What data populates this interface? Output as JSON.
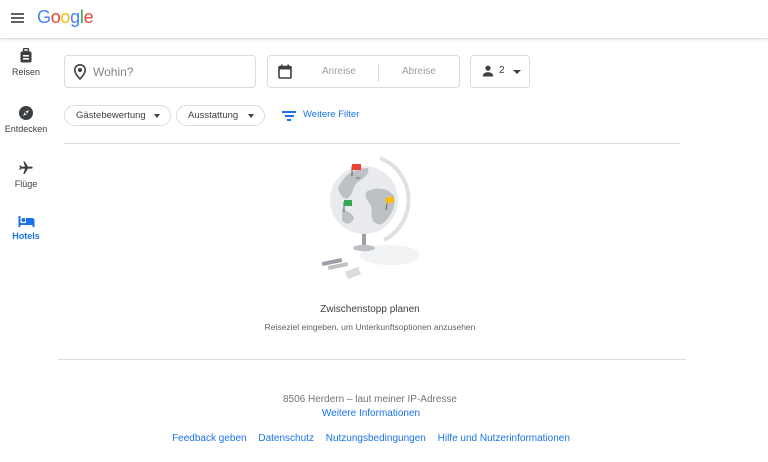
{
  "header": {
    "logo": {
      "G": "G",
      "o1": "o",
      "o2": "o",
      "g": "g",
      "l": "l",
      "e": "e"
    },
    "menu_icon": "hamburger-menu-icon"
  },
  "sidebar": {
    "items": [
      {
        "label": "Reisen",
        "icon": "suitcase-icon",
        "active": false
      },
      {
        "label": "Entdecken",
        "icon": "compass-icon",
        "active": false
      },
      {
        "label": "Flüge",
        "icon": "airplane-icon",
        "active": false
      },
      {
        "label": "Hotels",
        "icon": "bed-icon",
        "active": true
      }
    ]
  },
  "search": {
    "destination_placeholder": "Wohin?",
    "checkin_placeholder": "Anreise",
    "checkout_placeholder": "Abreise",
    "guests": "2"
  },
  "filters": {
    "rating_label": "Gästebewertung",
    "amenities_label": "Ausstattung",
    "more_filters_label": "Weitere Filter"
  },
  "empty_state": {
    "title": "Zwischenstopp planen",
    "subtitle": "Reiseziel eingeben, um Unterkunftsoptionen anzusehen"
  },
  "location": {
    "text": "8506 Herdern – laut meiner IP-Adresse",
    "more_info": "Weitere Informationen"
  },
  "footer": {
    "links": [
      "Feedback geben",
      "Datenschutz",
      "Nutzungsbedingungen",
      "Hilfe und Nutzerinformationen"
    ]
  },
  "colors": {
    "accent": "#1a73e8",
    "google_blue": "#4285f4",
    "google_red": "#ea4335",
    "google_yellow": "#fbbc05",
    "google_green": "#34a853"
  }
}
